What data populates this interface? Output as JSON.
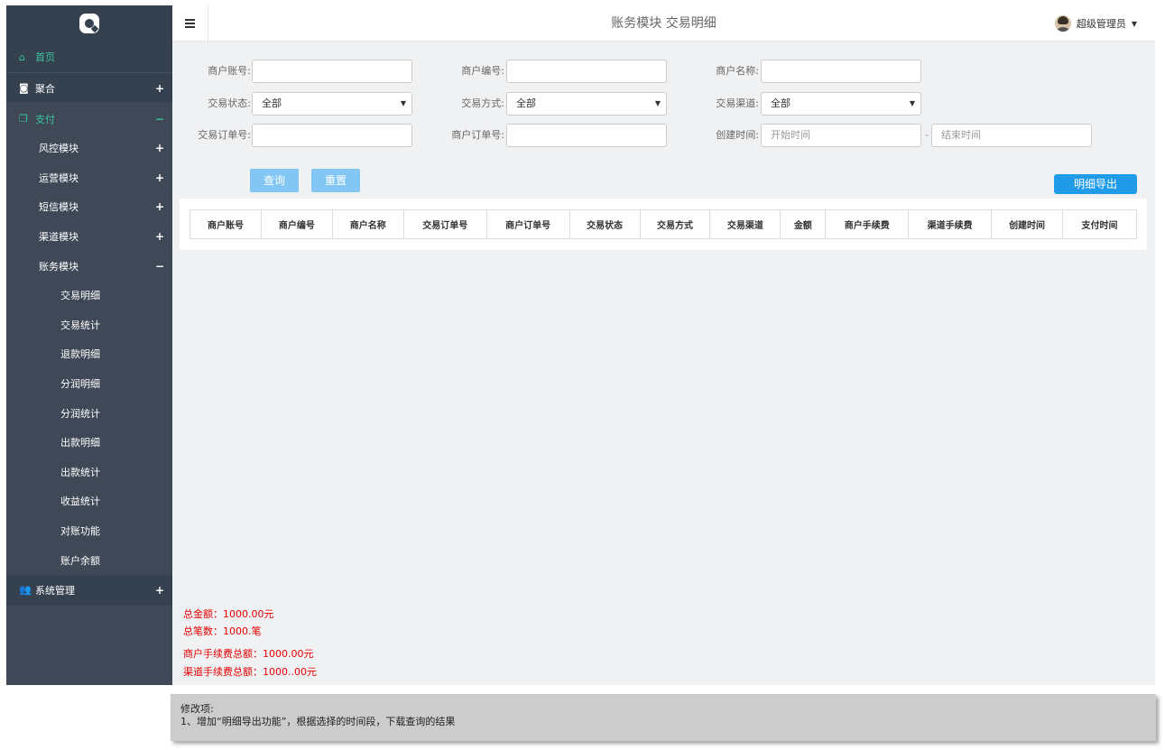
{
  "header": {
    "title": "账务模块 交易明细",
    "user_name": "超级管理员",
    "caret": "▼"
  },
  "sidebar": {
    "home": "首页",
    "juhe": "聚合",
    "zhifu": "支付",
    "sub_items": [
      {
        "label": "风控模块",
        "sign": "+"
      },
      {
        "label": "运营模块",
        "sign": "+"
      },
      {
        "label": "短信模块",
        "sign": "+"
      },
      {
        "label": "渠道模块",
        "sign": "+"
      },
      {
        "label": "账务模块",
        "sign": "−"
      }
    ],
    "leaf_items": [
      "交易明细",
      "交易统计",
      "退款明细",
      "分润明细",
      "分润统计",
      "出款明细",
      "出款统计",
      "收益统计",
      "对账功能",
      "账户余额"
    ],
    "system": "系统管理",
    "plus": "+",
    "minus": "−"
  },
  "filters": {
    "merchant_account": "商户账号:",
    "merchant_no": "商户编号:",
    "merchant_name": "商户名称:",
    "trade_status": "交易状态:",
    "trade_method": "交易方式:",
    "trade_channel": "交易渠道:",
    "trade_order": "交易订单号:",
    "merchant_order": "商户订单号:",
    "created_time": "创建时间:",
    "select_all": "全部",
    "start_placeholder": "开始时间",
    "end_placeholder": "结束时间",
    "dash": "-"
  },
  "buttons": {
    "query": "查询",
    "reset": "重置",
    "export": "明细导出"
  },
  "table": {
    "columns": [
      "商户账号",
      "商户编号",
      "商户名称",
      "交易订单号",
      "商户订单号",
      "交易状态",
      "交易方式",
      "交易渠道",
      "金额",
      "商户手续费",
      "渠道手续费",
      "创建时间",
      "支付时间"
    ]
  },
  "totals": {
    "total_amount": "总金额：1000.00元",
    "total_count": "总笔数：1000.笔",
    "merchant_fee": "商户手续费总额：1000.00元",
    "channel_fee": "渠道手续费总额：1000..00元"
  },
  "note": {
    "title": "修改项:",
    "line1": "1、增加“明细导出功能”，根据选择的时间段，下载查询的结果"
  }
}
